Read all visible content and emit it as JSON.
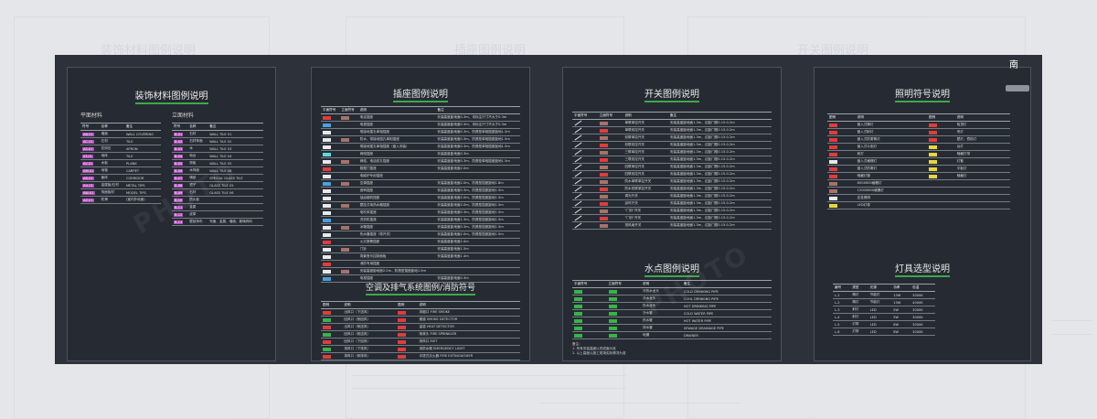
{
  "compass": {
    "label": "南"
  },
  "ghost_titles": [
    "装饰材料图例说明",
    "插座图例说明",
    "开关图例说明"
  ],
  "panel1": {
    "title": "装饰材料图例说明",
    "sub_left": "平面材料",
    "sub_right": "立面材料",
    "left_headers": [
      "符号",
      "名称",
      "备注"
    ],
    "left_rows": [
      [
        "AB-01",
        "墙面",
        "WALL COVERING"
      ],
      [
        "AC-01",
        "石材",
        "TILE"
      ],
      [
        "AS-01",
        "花岗石",
        "APRON"
      ],
      [
        "AT-01",
        "地砖",
        "TILE"
      ],
      [
        "AV-01",
        "木板",
        "PLANK"
      ],
      [
        "AM-01",
        "地毯",
        "CARPET"
      ],
      [
        "AR-01",
        "面砖",
        "CORRIDOR"
      ],
      [
        "AU-01",
        "金属板/石材",
        "METAL TIPS"
      ],
      [
        "AW-01",
        "饰面板材",
        "MODEL TIPS"
      ],
      [
        "AZ-01",
        "防滑",
        "(室内外地面)"
      ]
    ],
    "right_headers": [
      "符号",
      "名称",
      "备注"
    ],
    "right_rows": [
      [
        "B-01",
        "石材",
        "WALL TILE 01"
      ],
      [
        "B-02",
        "石材饰面",
        "WALL TILE 02"
      ],
      [
        "B-03",
        "木",
        "WALL TILE 03"
      ],
      [
        "B-04",
        "地台",
        "WALL TILE 04"
      ],
      [
        "B-05",
        "饰板",
        "WALL TILE 05"
      ],
      [
        "B-06",
        "木饰面",
        "WALL TILE 06"
      ],
      [
        "B-07",
        "墙纸",
        "SPECIAL GLASS TILE"
      ],
      [
        "B-08",
        "镜子",
        "GLASS TILE 05"
      ],
      [
        "B-09",
        "石材",
        "GLASS TILE 06"
      ],
      [
        "B-10",
        "防火板",
        ""
      ],
      [
        "B-11",
        "金属",
        ""
      ],
      [
        "B-12",
        "皮革",
        ""
      ],
      [
        "B-13",
        "壁纸饰布",
        "布面、金属、墙面、玻璃饰料"
      ]
    ]
  },
  "panel2": {
    "title": "插座图例说明",
    "headers": [
      "平面符号",
      "立面符号",
      "说明",
      "备注"
    ],
    "rows": [
      [
        "电话插座",
        "安装高度距地面0.3m，未标注尺寸不大于0.3m"
      ],
      [
        "电视插座",
        "安装高度距地面0.3m，未标注尺寸不大于0.3m"
      ],
      [
        "带接地插孔单相插座",
        "安装高度距地面0.3m，防溅型单相插座距地1.5m"
      ],
      [
        "防水、带接地插孔单相插座",
        "安装高度距地面0.3m，防溅型单相插座距地1.5m"
      ],
      [
        "带接地插孔单相插座（嵌入安装）",
        "安装高度距地面0.3m，防溅型单相插座距地1.5m"
      ],
      [
        "网络插座",
        "安装高度距地面0.3m"
      ],
      [
        "网络、电话双孔插座",
        "安装高度距地面0.3m，防溅型单相插座距地1.5m"
      ],
      [
        "数据门插座",
        "安装高度距地面2.0m"
      ],
      [
        "电磁炉专用插座",
        ""
      ],
      [
        "空调插座",
        "安装高度距地面2.0m，防溅型插座距地1.8m"
      ],
      [
        "音响插座",
        "安装高度距地面0.3m，防溅型插座距地1.5m"
      ],
      [
        "抽油烟机插座",
        "安装高度距地面2.0m，防溅型插座距地1.5m"
      ],
      [
        "壁挂式电热水器插座",
        "安装高度距地面2.0m，防溅型插座距地1.5m"
      ],
      [
        "电吹风插座",
        "安装高度距地面0.3m，防溅型插座距地1.5m"
      ],
      [
        "洗衣机插座",
        "安装高度距地面1.3m，防溅型插座距地1.5m"
      ],
      [
        "冰箱插座",
        "安装高度距地面0.3m，防溅型插座距地1.5m"
      ],
      [
        "热水器插座（带开关）",
        "安装高度距地面2.0m，防溅型插座距地1.5m"
      ],
      [
        "火灾报警插座",
        "安装高度距地面2.0m"
      ],
      [
        "门铃",
        "安装高度距地面1.5m"
      ],
      [
        "背景音乐控制面板",
        "安装高度距地面1.4m"
      ],
      [
        "消防专用插座",
        ""
      ],
      [
        "安装高度距地面2.0m，防溅型插座距地1.5m",
        ""
      ],
      [
        "电视插座",
        "安装高度距地面0.3m"
      ]
    ],
    "hvac_title": "空调及排气系统图例/消防符号",
    "hvac_headers": [
      "图例",
      "说明",
      "图例",
      "说明"
    ],
    "hvac_rows": [
      [
        "出风口（下送风）",
        "排烟口",
        "FIRE SMOKE"
      ],
      [
        "回风口（侧回风）",
        "烟感",
        "SMOKE DETECTOR"
      ],
      [
        "出风口（侧送风）",
        "温感",
        "HEAT DETECTOR"
      ],
      [
        "回风口（侧送风）",
        "喷淋头",
        "FIRE SPRINKLER"
      ],
      [
        "回风口（下回风）",
        "排风口",
        "EXIT"
      ],
      [
        "排风口（下排风）",
        "消防水喉",
        "EMERGENCY LIGHT"
      ],
      [
        "排风口（侧排风）",
        "手提式灭火器",
        "FIRE EXTINGUISHER"
      ]
    ]
  },
  "panel3": {
    "title": "开关图例说明",
    "headers": [
      "平面符号",
      "立面符号",
      "说明",
      "备注"
    ],
    "rows": [
      [
        "单联单控开关",
        "安装高度距地面1.3m，边距门框0.15-0.2m"
      ],
      [
        "单联双控开关",
        "安装高度距地面1.3m，边距门框0.15-0.2m"
      ],
      [
        "双联单控开关",
        "安装高度距地面1.3m，边距门框0.15-0.2m"
      ],
      [
        "双联双控开关",
        "安装高度距地面1.3m，边距门框0.15-0.2m"
      ],
      [
        "三联单控开关",
        "安装高度距地面1.3m，边距门框0.15-0.2m"
      ],
      [
        "三联双控开关",
        "安装高度距地面1.3m，边距门框0.15-0.2m"
      ],
      [
        "四联单控开关",
        "安装高度距地面1.3m，边距门框0.15-0.2m"
      ],
      [
        "四联双控开关",
        "安装高度距地面1.3m，边距门框0.15-0.2m"
      ],
      [
        "防水单联单控开关",
        "安装高度距地面1.3m，边距门框0.15-0.2m"
      ],
      [
        "防水双联单控开关",
        "安装高度距地面1.3m，边距门框0.15-0.2m"
      ],
      [
        "调光开关",
        "安装高度距地面1.3m，边距门框0.15-0.2m"
      ],
      [
        "延时开关",
        "安装高度距地面1.3m，边距门框0.15-0.2m"
      ],
      [
        "\"门铃\"开关",
        "安装高度距地面1.3m，边距门框0.15-0.2m"
      ],
      [
        "\"门铃\"开关",
        "安装高度距地面1.3m，边距门框0.15-0.2m"
      ],
      [
        "排风扇开关",
        "安装高度距地面1.3m，边距门框0.15-0.2m"
      ]
    ],
    "water_title": "水点图例说明",
    "water_headers": [
      "平面符号",
      "立面符号",
      "说明",
      "备注"
    ],
    "water_rows": [
      [
        "冷热水龙头",
        "COLD DRINKING PIPE"
      ],
      [
        "冷水龙头",
        "COOL DRINKING PIPE"
      ],
      [
        "热水龙头",
        "HOT DRINKING PIPE"
      ],
      [
        "冷水管",
        "COLD WATER PIPE"
      ],
      [
        "热水管",
        "HOT WATER PIPE"
      ],
      [
        "排水管",
        "SEWAGE DRAINAGE PIPE"
      ],
      [
        "地漏",
        "DRAINER"
      ]
    ],
    "notes": [
      "备注：",
      "1. 所有安装高度以完成面为准",
      "2. 以上高度以施工现场实际情况为准"
    ]
  },
  "panel4": {
    "title": "照明符号说明",
    "headers": [
      "图例",
      "说明",
      "图例",
      "说明"
    ],
    "rows": [
      [
        "嵌入式筒灯",
        "吸顶灯"
      ],
      [
        "嵌入式射灯",
        "吊灯"
      ],
      [
        "嵌入式防雾筒灯",
        "壁灯、镜前灯"
      ],
      [
        "嵌入式斗胆灯",
        "台灯"
      ],
      [
        "射灯",
        "暗藏灯带"
      ],
      [
        "嵌入式格栅灯",
        "灯管"
      ],
      [
        "嵌入式防雾灯",
        "平板灯"
      ],
      [
        "暗藏灯管",
        "暗藏灯"
      ],
      [
        "600X600格栅灯",
        ""
      ],
      [
        "1200X600格栅灯",
        ""
      ],
      [
        "应急照明",
        ""
      ],
      [
        "LED灯带",
        ""
      ]
    ],
    "lamp_title": "灯具选型说明",
    "lamp_headers": [
      "编号",
      "类型",
      "光源",
      "功率",
      "色温"
    ],
    "lamp_rows": [
      [
        "L-1",
        "筒灯",
        "节能灯",
        "13W",
        "3000K"
      ],
      [
        "L-2",
        "筒灯",
        "节能灯",
        "13W",
        "4000K"
      ],
      [
        "L-3",
        "射灯",
        "LED",
        "5W",
        "3000K"
      ],
      [
        "L-4",
        "射灯",
        "LED",
        "5W",
        "3000K"
      ],
      [
        "L-5",
        "灯带",
        "LED",
        "8W",
        "3000K"
      ],
      [
        "L-6",
        "灯带",
        "LED",
        "8W",
        "3000K"
      ]
    ]
  }
}
